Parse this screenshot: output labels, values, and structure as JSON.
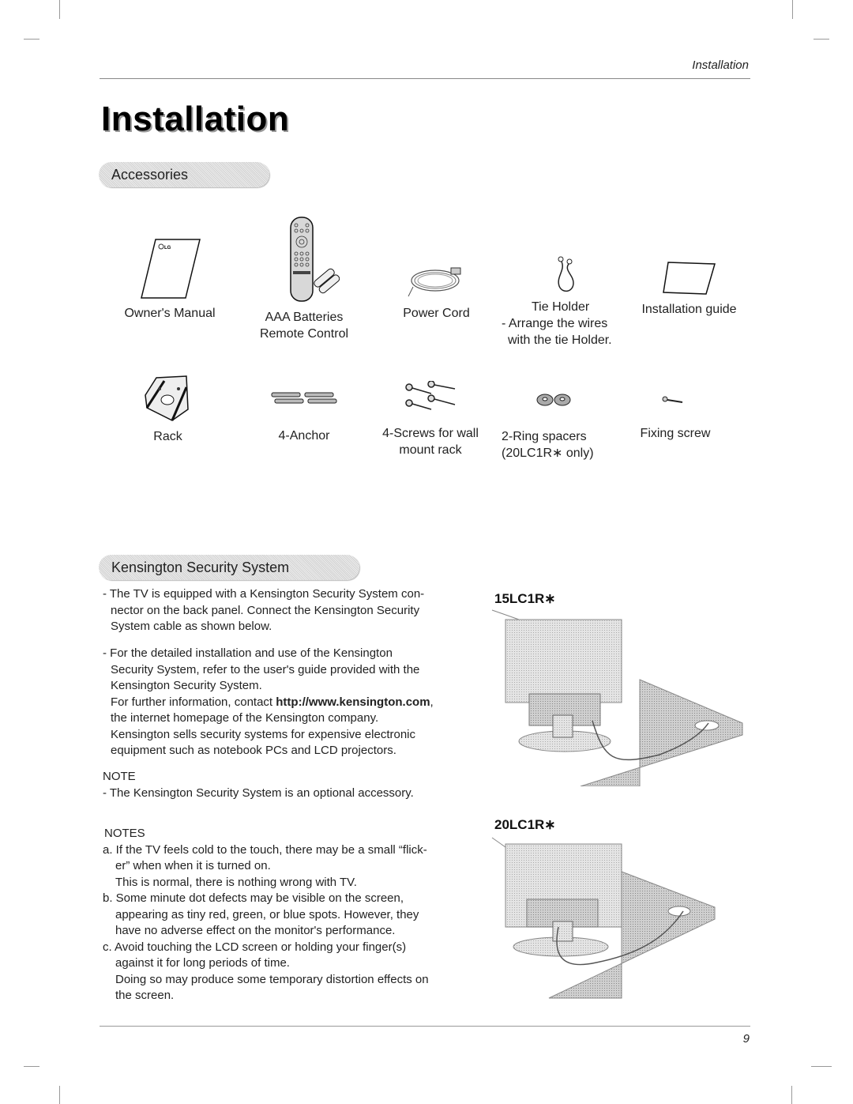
{
  "header": {
    "section_label": "Installation"
  },
  "title": "Installation",
  "accessories": {
    "heading": "Accessories",
    "row1": [
      {
        "icon": "manual-booklet-icon",
        "label": [
          "Owner's Manual"
        ]
      },
      {
        "icon": "remote-control-icon",
        "label": [
          "AAA Batteries",
          "Remote Control"
        ]
      },
      {
        "icon": "power-cord-icon",
        "label": [
          "Power Cord"
        ]
      },
      {
        "icon": "tie-holder-icon",
        "label": [
          "Tie Holder",
          "- Arrange the wires",
          "with the tie Holder."
        ]
      },
      {
        "icon": "installation-guide-icon",
        "label": [
          "Installation guide"
        ]
      }
    ],
    "row2": [
      {
        "icon": "rack-icon",
        "label": [
          "Rack"
        ]
      },
      {
        "icon": "anchor-icon",
        "label": [
          "4-Anchor"
        ]
      },
      {
        "icon": "screws-icon",
        "label": [
          "4-Screws for wall",
          "mount rack"
        ]
      },
      {
        "icon": "ring-spacers-icon",
        "label": [
          "2-Ring spacers",
          "(20LC1R∗ only)"
        ]
      },
      {
        "icon": "fixing-screw-icon",
        "label": [
          "Fixing screw"
        ]
      }
    ]
  },
  "kensington": {
    "heading": "Kensington Security System",
    "para1": [
      "- The TV is equipped with a Kensington Security System con-",
      "nector on the back panel. Connect the Kensington Security",
      "System cable as shown below."
    ],
    "para2": [
      "- For the detailed installation and use of the Kensington",
      "Security System, refer to the user's guide provided with the",
      "Kensington Security System."
    ],
    "para3_prefix": "For further information, contact ",
    "para3_url": "http://www.kensington.com",
    "para3_suffix": ",",
    "para3_rest": [
      "the internet homepage of the Kensington company.",
      "Kensington sells security systems for expensive electronic",
      "equipment such as notebook PCs and LCD projectors."
    ],
    "note_heading": "NOTE",
    "note_text": "- The Kensington Security System is an optional accessory.",
    "models": [
      "15LC1R∗",
      "20LC1R∗"
    ]
  },
  "notes": {
    "heading": "NOTES",
    "a": [
      "a. If the TV feels cold to the touch, there may be a small “flick-",
      "er” when when it is turned on.",
      "This is normal, there is nothing wrong with TV."
    ],
    "b": [
      "b. Some minute dot defects may be visible on the screen,",
      "appearing as tiny red, green, or blue spots. However, they",
      "have no adverse effect on the monitor's performance."
    ],
    "c": [
      "c. Avoid touching the LCD screen or holding your finger(s)",
      "against it for long periods of time.",
      "Doing so may produce some temporary distortion effects on",
      "the screen."
    ]
  },
  "footer": {
    "page_number": "9"
  }
}
